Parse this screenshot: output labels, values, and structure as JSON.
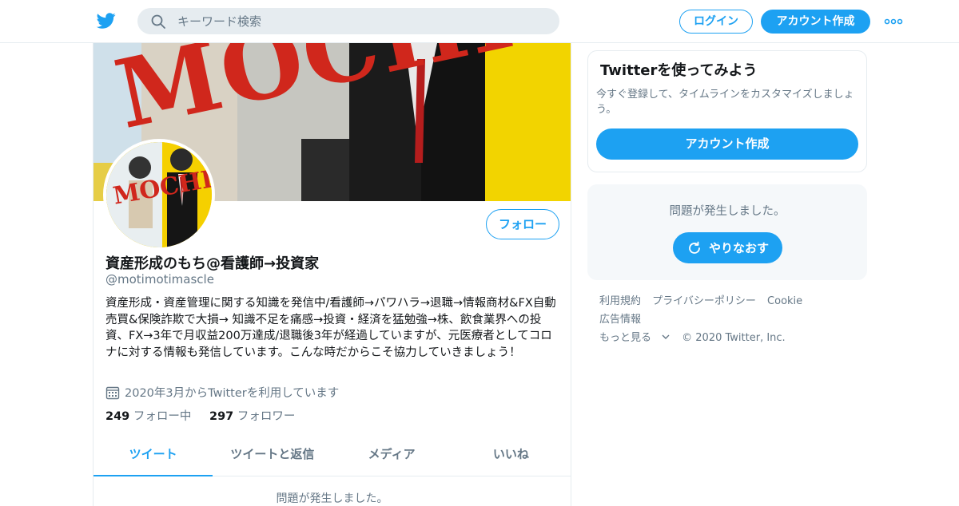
{
  "topbar": {
    "logo_icon": "twitter-bird-icon",
    "search_placeholder": "キーワード検索",
    "login_label": "ログイン",
    "signup_label": "アカウント作成",
    "more_icon": "more-dots-icon"
  },
  "profile": {
    "banner_text": "MOCHI",
    "avatar_text": "MOCHI",
    "follow_label": "フォロー",
    "name": "資産形成のもち@看護師→投資家",
    "handle": "@motimotimascle",
    "bio": "資産形成・資産管理に関する知識を発信中/看護師→パワハラ→退職→情報商材&FX自動売買&保険詐欺で大損→ 知識不足を痛感→投資・経済を猛勉強→株、飲食業界への投資、FX→3年で月収益200万達成/退職後3年が経過していますが、元医療者としてコロナに対する情報も発信しています。こんな時だからこそ協力していきましょう！",
    "joined": "2020年3月からTwitterを利用しています",
    "following_count": "249",
    "following_label": "フォロー中",
    "followers_count": "297",
    "followers_label": "フォロワー"
  },
  "tabs": [
    {
      "label": "ツイート",
      "active": true
    },
    {
      "label": "ツイートと返信",
      "active": false
    },
    {
      "label": "メディア",
      "active": false
    },
    {
      "label": "いいね",
      "active": false
    }
  ],
  "timeline_error": "問題が発生しました。",
  "sidebar": {
    "signup_card": {
      "title": "Twitterを使ってみよう",
      "description": "今すぐ登録して、タイムラインをカスタマイズしましょう。",
      "button_label": "アカウント作成"
    },
    "error_card": {
      "message": "問題が発生しました。",
      "retry_label": "やりなおす"
    },
    "footer": {
      "links": [
        "利用規約",
        "プライバシーポリシー",
        "Cookie",
        "広告情報"
      ],
      "more_label": "もっと見る",
      "copyright": "© 2020 Twitter, Inc."
    }
  },
  "colors": {
    "brand": "#1da1f2",
    "secondary_text": "#657786",
    "border": "#e6ecf0"
  }
}
